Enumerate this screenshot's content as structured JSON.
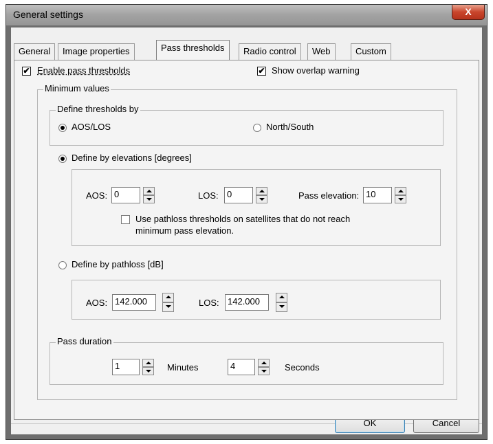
{
  "window": {
    "title": "General settings",
    "close_glyph": "X",
    "colors": {
      "titlebar": "#a4a4a4",
      "close": "#c9452c",
      "client": "#f0f0f0"
    }
  },
  "tabs": [
    {
      "label": "General",
      "active": false
    },
    {
      "label": "Image properties",
      "active": false
    },
    {
      "label": "Pass thresholds",
      "active": true
    },
    {
      "label": "Radio control",
      "active": false
    },
    {
      "label": "Web",
      "active": false
    },
    {
      "label": "Custom",
      "active": false
    }
  ],
  "panel": {
    "enable_pass_thresholds": {
      "label": "Enable pass thresholds",
      "checked": true
    },
    "show_overlap_warning": {
      "label": "Show overlap warning",
      "checked": true
    },
    "check_glyph": "✔",
    "minimum_values": {
      "title": "Minimum values",
      "define_thresholds_by": {
        "title": "Define thresholds by",
        "options": [
          {
            "label": "AOS/LOS",
            "selected": true
          },
          {
            "label": "North/South",
            "selected": false
          }
        ]
      },
      "define_by_elevations": {
        "label": "Define by elevations [degrees]",
        "selected": true,
        "aos_label": "AOS:",
        "aos_value": "0",
        "los_label": "LOS:",
        "los_value": "0",
        "pass_elevation_label": "Pass elevation:",
        "pass_elevation_value": "10",
        "pathloss_check": {
          "line1": "Use pathloss thresholds on satellites that do not reach",
          "line2": "minimum pass elevation.",
          "checked": false
        }
      },
      "define_by_pathloss": {
        "label": "Define by pathloss [dB]",
        "selected": false,
        "aos_label": "AOS:",
        "aos_value": "142.000",
        "los_label": "LOS:",
        "los_value": "142.000"
      },
      "pass_duration": {
        "title": "Pass duration",
        "minutes_value": "1",
        "minutes_label": "Minutes",
        "seconds_value": "4",
        "seconds_label": "Seconds"
      }
    }
  },
  "buttons": {
    "ok": "OK",
    "cancel": "Cancel"
  }
}
